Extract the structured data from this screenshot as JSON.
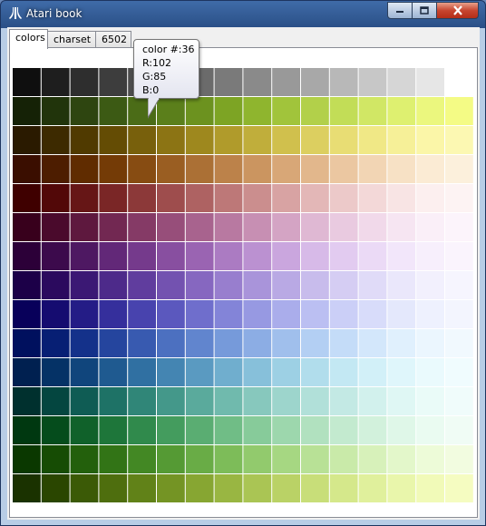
{
  "window": {
    "title": "Atari book"
  },
  "tabs": [
    {
      "label": "colors",
      "active": true
    },
    {
      "label": "charset",
      "active": false
    },
    {
      "label": "6502",
      "active": false
    }
  ],
  "tooltip": {
    "color_label": "color #:36",
    "r": "R:102",
    "g": "G:85",
    "b": "B:0"
  },
  "palette": {
    "columns": 16,
    "rows": [
      [
        "#0f0f0f",
        "#1e1e1e",
        "#2e2e2e",
        "#3d3d3d",
        "#4c4c4c",
        "#5c5c5c",
        "#6b6b6b",
        "#7a7a7a",
        "#8a8a8a",
        "#999999",
        "#a8a8a8",
        "#b8b8b8",
        "#c7c7c7",
        "#d6d6d6",
        "#e6e6e6",
        "#ffffff"
      ],
      [
        "#152206",
        "#21340b",
        "#2e4510",
        "#3c5a14",
        "#4b6c17",
        "#5b7f1b",
        "#6c921f",
        "#7da424",
        "#8fb52e",
        "#a1c43b",
        "#b2d04a",
        "#c2dd57",
        "#d1e765",
        "#def070",
        "#ebf77e",
        "#f4fb85"
      ],
      [
        "#2a1a00",
        "#3d2a00",
        "#503a00",
        "#644c04",
        "#78600c",
        "#8c7414",
        "#9e881e",
        "#b09b2b",
        "#c0ae3b",
        "#d0c04d",
        "#dccf60",
        "#e8dd74",
        "#f0e886",
        "#f6f098",
        "#fbf6a8",
        "#fcf8b2"
      ],
      [
        "#3a0e00",
        "#4d1d00",
        "#602c00",
        "#743b06",
        "#874c12",
        "#9a5e22",
        "#ab7035",
        "#bc824a",
        "#cb9560",
        "#d8a777",
        "#e2b78c",
        "#ebc7a1",
        "#f2d5b4",
        "#f7e1c5",
        "#fbebd4",
        "#fcf0dc"
      ],
      [
        "#3f0000",
        "#520808",
        "#661616",
        "#7a2626",
        "#8c3939",
        "#9e4d4d",
        "#ae6262",
        "#bd7878",
        "#cb8e8e",
        "#d8a3a3",
        "#e3b7b7",
        "#ecc9c9",
        "#f3d8d8",
        "#f8e4e4",
        "#fcefef",
        "#fdf3f3"
      ],
      [
        "#38001c",
        "#4a0a2c",
        "#5e183e",
        "#722852",
        "#853a66",
        "#974e7a",
        "#a8638e",
        "#b879a1",
        "#c78fb3",
        "#d4a4c4",
        "#dfb8d3",
        "#e9cae0",
        "#f1d9ea",
        "#f6e5f2",
        "#faeff8",
        "#fcf4fb"
      ],
      [
        "#2c0038",
        "#3c0a4c",
        "#4e1862",
        "#622878",
        "#753a8c",
        "#884fa0",
        "#9a64b2",
        "#ab7bc2",
        "#bb91d1",
        "#caa6de",
        "#d7bae8",
        "#e2cbf0",
        "#ebdaf6",
        "#f2e6fa",
        "#f7effc",
        "#faf4fd"
      ],
      [
        "#1c0048",
        "#2b0a5e",
        "#3b1874",
        "#4d2a8a",
        "#603d9e",
        "#7352b0",
        "#8667c0",
        "#987ece",
        "#a994da",
        "#b9a9e4",
        "#c8bcec",
        "#d5cdf3",
        "#e0dbf8",
        "#eae7fb",
        "#f2f0fd",
        "#f6f5fe"
      ],
      [
        "#08005a",
        "#150c70",
        "#241c86",
        "#352f9c",
        "#4843ae",
        "#5b58be",
        "#6f6ecc",
        "#8384d8",
        "#9799e2",
        "#aaadeb",
        "#bbbff2",
        "#cbcff7",
        "#d8dcfa",
        "#e4e8fc",
        "#eef1fe",
        "#f3f5fe"
      ],
      [
        "#00105e",
        "#071f74",
        "#14318a",
        "#25459e",
        "#385ab0",
        "#4c70c0",
        "#6185ce",
        "#769ada",
        "#8cade4",
        "#a0bfec",
        "#b3cff3",
        "#c4dcf8",
        "#d3e7fb",
        "#e0f0fd",
        "#ebf6fe",
        "#f1f9fe"
      ],
      [
        "#002050",
        "#053266",
        "#10457c",
        "#1f5a90",
        "#3070a2",
        "#4485b2",
        "#5a9ac1",
        "#70aece",
        "#87c0da",
        "#9dd0e4",
        "#b1ddec",
        "#c3e8f3",
        "#d2f0f8",
        "#dff6fb",
        "#eafafd",
        "#f0fcfe"
      ],
      [
        "#00302e",
        "#044640",
        "#0f5c54",
        "#1e7266",
        "#308678",
        "#44988a",
        "#5aaa9c",
        "#70baad",
        "#87c8bd",
        "#9dd5cc",
        "#b1e0d9",
        "#c3e9e4",
        "#d2f1ed",
        "#dff7f4",
        "#eafbf8",
        "#f0fcfb"
      ],
      [
        "#003810",
        "#054c1c",
        "#10612a",
        "#1e763a",
        "#308a4c",
        "#449c5e",
        "#5aad72",
        "#70bd86",
        "#87cb9a",
        "#9dd7ad",
        "#b1e1bf",
        "#c3eacf",
        "#d2f1dc",
        "#dff7e8",
        "#eafbf1",
        "#f0fcf5"
      ],
      [
        "#0a3800",
        "#164c04",
        "#23600c",
        "#327416",
        "#438824",
        "#559a34",
        "#69ac46",
        "#7dbc59",
        "#92ca6d",
        "#a6d782",
        "#b8e196",
        "#c9eaa9",
        "#d7f1ba",
        "#e3f7ca",
        "#edfbd8",
        "#f2fce0"
      ],
      [
        "#1a3200",
        "#2a4600",
        "#3b5a06",
        "#4e6e0e",
        "#618218",
        "#749424",
        "#87a632",
        "#99b642",
        "#aac554",
        "#bad266",
        "#c8de79",
        "#d5e88b",
        "#e0f09c",
        "#e9f6ab",
        "#f1fab8",
        "#f5fcc1"
      ]
    ]
  }
}
